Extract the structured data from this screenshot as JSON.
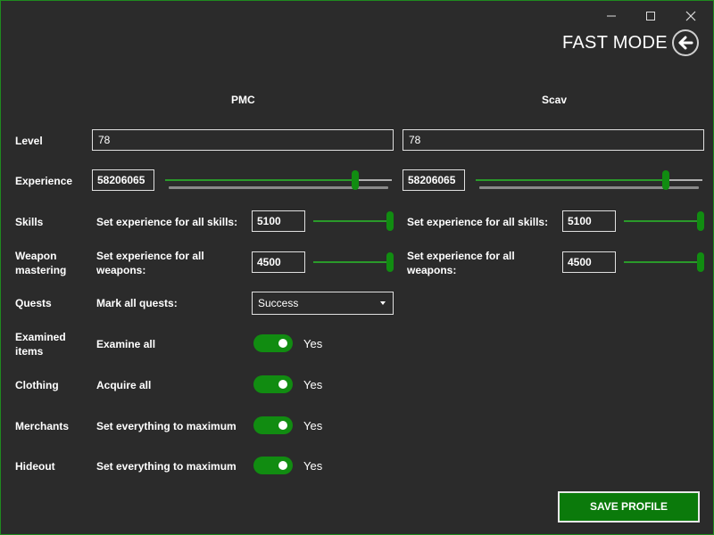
{
  "window": {
    "controls": {
      "minimize": "—",
      "maximize": "☐",
      "close": "✕"
    },
    "title": "FAST MODE"
  },
  "columns": {
    "pmc": "PMC",
    "scav": "Scav"
  },
  "rows": {
    "level": "Level",
    "experience": "Experience",
    "skills": "Skills",
    "weapon_line1": "Weapon",
    "weapon_line2": "mastering",
    "quests": "Quests",
    "examined_line1": "Examined",
    "examined_line2": "items",
    "clothing": "Clothing",
    "merchants": "Merchants",
    "hideout": "Hideout"
  },
  "pmc": {
    "level": "78",
    "experience": "58206065",
    "experience_slider": 0.85,
    "skills_label": "Set experience for all skills:",
    "skills_value": "5100",
    "skills_slider": 1.0,
    "weapons_label_line1": "Set experience for all",
    "weapons_label_line2": "weapons:",
    "weapons_value": "4500",
    "weapons_slider": 1.0,
    "quests_label": "Mark all quests:",
    "quests_value": "Success",
    "examine_label": "Examine all",
    "clothing_label": "Acquire all",
    "merchants_label": "Set everything to maximum",
    "hideout_label": "Set everything to maximum",
    "toggle_text": "Yes"
  },
  "scav": {
    "level": "78",
    "experience": "58206065",
    "experience_slider": 0.85,
    "skills_label": "Set experience for all skills:",
    "skills_value": "5100",
    "skills_slider": 1.0,
    "weapons_label_line1": "Set experience for all",
    "weapons_label_line2": "weapons:",
    "weapons_value": "4500",
    "weapons_slider": 1.0
  },
  "actions": {
    "save": "SAVE PROFILE"
  },
  "colors": {
    "accent": "#118c11",
    "background": "#2b2b2b",
    "border": "#1f8a1f"
  },
  "icons": {
    "back": "arrow-left-icon",
    "dropdown": "chevron-down-icon"
  }
}
